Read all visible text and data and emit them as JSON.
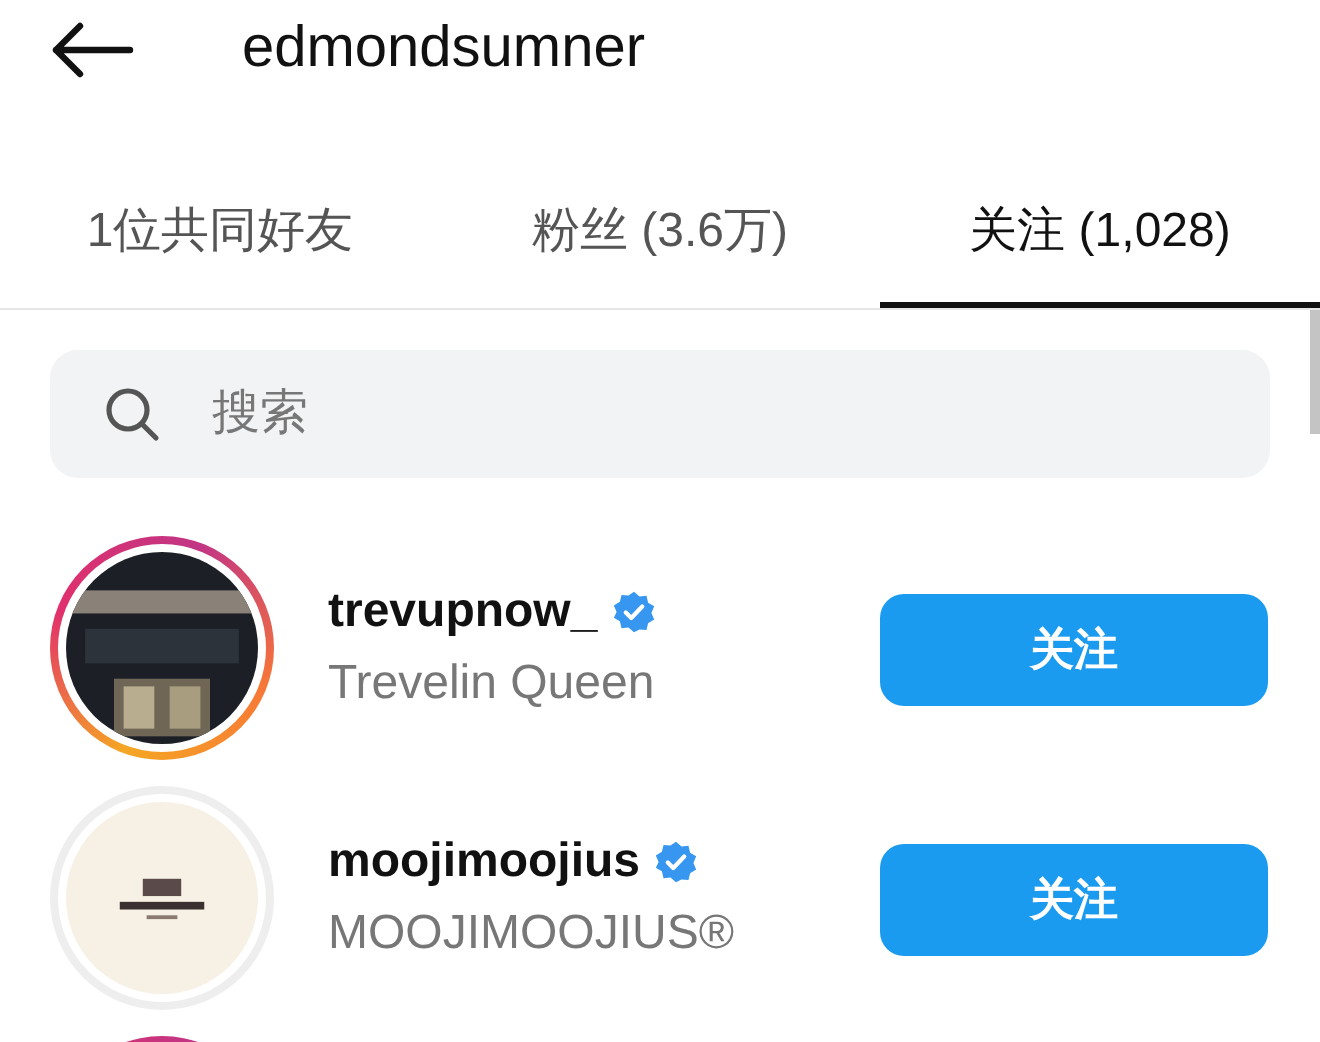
{
  "header": {
    "title": "edmondsumner"
  },
  "tabs": [
    {
      "label": "1位共同好友",
      "selected": false
    },
    {
      "label": "粉丝 (3.6万)",
      "selected": false
    },
    {
      "label": "关注 (1,028)",
      "selected": true
    }
  ],
  "search": {
    "placeholder": "搜索"
  },
  "users": [
    {
      "username": "trevupnow_",
      "verified": true,
      "name": "Trevelin Queen",
      "story_ring": true,
      "button": "关注"
    },
    {
      "username": "moojimoojius",
      "verified": true,
      "name": "MOOJIMOOJIUS®",
      "story_ring": false,
      "button": "关注"
    },
    {
      "story_ring": true
    }
  ]
}
